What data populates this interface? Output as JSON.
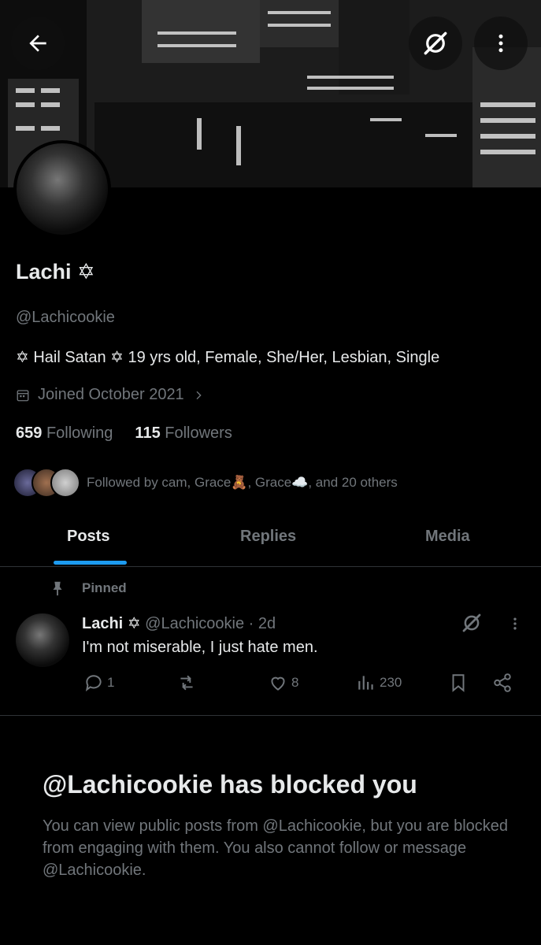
{
  "colors": {
    "background": "#000000",
    "text": "#e7e9ea",
    "muted": "#71767b",
    "accent": "#1d9bf0",
    "border": "#2f3336"
  },
  "header": {
    "back_icon": "arrow-left-icon",
    "grok_icon": "grok-icon",
    "more_icon": "more-vertical-icon"
  },
  "profile": {
    "name": "Lachi",
    "name_glyph": "✡",
    "handle": "@Lachicookie",
    "bio": "✡ Hail Satan ✡  19 yrs old, Female, She/Her, Lesbian, Single",
    "joined": "Joined October 2021",
    "following_count": "659",
    "following_label": "Following",
    "followers_count": "115",
    "followers_label": "Followers",
    "followed_by": "Followed by cam, Grace🧸, Grace☁️, and 20 others"
  },
  "tabs": [
    {
      "label": "Posts",
      "active": true
    },
    {
      "label": "Replies",
      "active": false
    },
    {
      "label": "Media",
      "active": false
    }
  ],
  "pinned_post": {
    "pinned_label": "Pinned",
    "author_name": "Lachi",
    "author_glyph": "✡",
    "author_handle": "@Lachicookie",
    "time": "· 2d",
    "text": "I'm not miserable, I just hate men.",
    "replies": "1",
    "reposts": "",
    "likes": "8",
    "views": "230"
  },
  "blocked": {
    "title": "@Lachicookie has blocked you",
    "message": "You can view public posts from @Lachicookie, but you are blocked from engaging with them. You also cannot follow or message @Lachicookie."
  }
}
